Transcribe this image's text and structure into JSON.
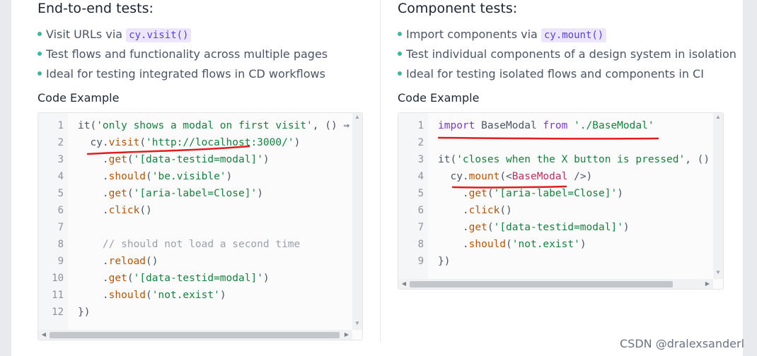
{
  "left": {
    "title": "End-to-end tests:",
    "points": [
      {
        "pre": "Visit URLs via ",
        "code": "cy.visit()"
      },
      {
        "pre": "Test flows and functionality across multiple pages",
        "code": ""
      },
      {
        "pre": "Ideal for testing integrated flows in CD workflows",
        "code": ""
      }
    ],
    "example_label": "Code Example",
    "line_numbers": [
      "1",
      "2",
      "3",
      "4",
      "5",
      "6",
      "7",
      "8",
      "9",
      "10",
      "11",
      "12"
    ]
  },
  "right": {
    "title": "Component tests:",
    "points": [
      {
        "pre": "Import components via ",
        "code": "cy.mount()"
      },
      {
        "pre": "Test individual components of a design system in isolation",
        "code": ""
      },
      {
        "pre": "Ideal for testing isolated flows and components in CI",
        "code": ""
      }
    ],
    "example_label": "Code Example",
    "line_numbers": [
      "1",
      "2",
      "3",
      "4",
      "5",
      "6",
      "7",
      "8",
      "9"
    ]
  },
  "code_left": [
    [
      [
        "it(",
        "pl"
      ],
      [
        "'only shows a modal on first visit'",
        "str"
      ],
      [
        ", () ⇒",
        "pl"
      ]
    ],
    [
      [
        "  cy.",
        "pl"
      ],
      [
        "visit",
        "fn"
      ],
      [
        "(",
        "pl"
      ],
      [
        "'http://localhost:3000/'",
        "str"
      ],
      [
        ")",
        "pl"
      ]
    ],
    [
      [
        "    .",
        "pl"
      ],
      [
        "get",
        "fn"
      ],
      [
        "(",
        "pl"
      ],
      [
        "'[data-testid=modal]'",
        "str"
      ],
      [
        ")",
        "pl"
      ]
    ],
    [
      [
        "    .",
        "pl"
      ],
      [
        "should",
        "fn"
      ],
      [
        "(",
        "pl"
      ],
      [
        "'be.visible'",
        "str"
      ],
      [
        ")",
        "pl"
      ]
    ],
    [
      [
        "    .",
        "pl"
      ],
      [
        "get",
        "fn"
      ],
      [
        "(",
        "pl"
      ],
      [
        "'[aria-label=Close]'",
        "str"
      ],
      [
        ")",
        "pl"
      ]
    ],
    [
      [
        "    .",
        "pl"
      ],
      [
        "click",
        "fn"
      ],
      [
        "()",
        "pl"
      ]
    ],
    [],
    [
      [
        "    // should not load a second time",
        "cm"
      ]
    ],
    [
      [
        "    .",
        "pl"
      ],
      [
        "reload",
        "fn"
      ],
      [
        "()",
        "pl"
      ]
    ],
    [
      [
        "    .",
        "pl"
      ],
      [
        "get",
        "fn"
      ],
      [
        "(",
        "pl"
      ],
      [
        "'[data-testid=modal]'",
        "str"
      ],
      [
        ")",
        "pl"
      ]
    ],
    [
      [
        "    .",
        "pl"
      ],
      [
        "should",
        "fn"
      ],
      [
        "(",
        "pl"
      ],
      [
        "'not.exist'",
        "str"
      ],
      [
        ")",
        "pl"
      ]
    ],
    [
      [
        "})",
        "pl"
      ]
    ]
  ],
  "code_right": [
    [
      [
        "import",
        "kw"
      ],
      [
        " BaseModal ",
        "pl"
      ],
      [
        "from",
        "kw"
      ],
      [
        " ",
        "pl"
      ],
      [
        "'./BaseModal'",
        "str"
      ]
    ],
    [],
    [
      [
        "it(",
        "pl"
      ],
      [
        "'closes when the X button is pressed'",
        "str"
      ],
      [
        ", ()",
        "pl"
      ]
    ],
    [
      [
        "  cy.",
        "pl"
      ],
      [
        "mount",
        "fn"
      ],
      [
        "(<",
        "pl"
      ],
      [
        "BaseModal",
        "tag"
      ],
      [
        " />)",
        "pl"
      ]
    ],
    [
      [
        "    .",
        "pl"
      ],
      [
        "get",
        "fn"
      ],
      [
        "(",
        "pl"
      ],
      [
        "'[aria-label=Close]'",
        "str"
      ],
      [
        ")",
        "pl"
      ]
    ],
    [
      [
        "    .",
        "pl"
      ],
      [
        "click",
        "fn"
      ],
      [
        "()",
        "pl"
      ]
    ],
    [
      [
        "    .",
        "pl"
      ],
      [
        "get",
        "fn"
      ],
      [
        "(",
        "pl"
      ],
      [
        "'[data-testid=modal]'",
        "str"
      ],
      [
        ")",
        "pl"
      ]
    ],
    [
      [
        "    .",
        "pl"
      ],
      [
        "should",
        "fn"
      ],
      [
        "(",
        "pl"
      ],
      [
        "'not.exist'",
        "str"
      ],
      [
        ")",
        "pl"
      ]
    ],
    [
      [
        "})",
        "pl"
      ]
    ]
  ],
  "watermark": "CSDN @dralexsanderl"
}
